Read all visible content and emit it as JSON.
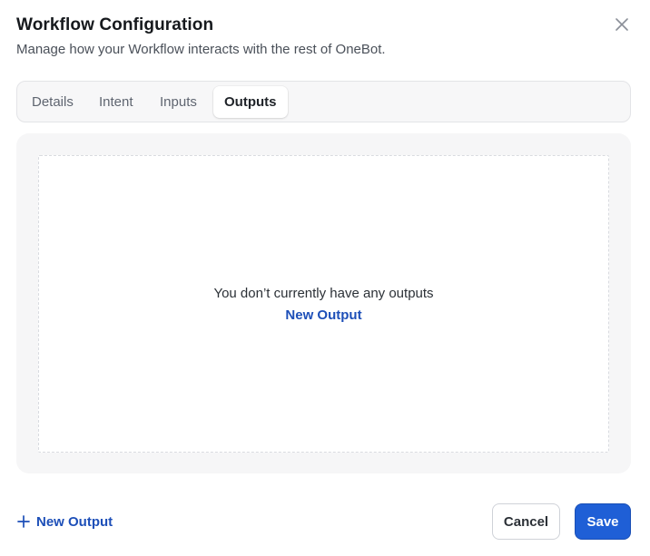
{
  "dialog": {
    "title": "Workflow Configuration",
    "subtitle": "Manage how your Workflow interacts with the rest of OneBot.",
    "close_icon": "close-icon"
  },
  "tabs": [
    {
      "label": "Details",
      "active": false
    },
    {
      "label": "Intent",
      "active": false
    },
    {
      "label": "Inputs",
      "active": false
    },
    {
      "label": "Outputs",
      "active": true
    }
  ],
  "empty_state": {
    "message": "You don’t currently have any outputs",
    "link_label": "New Output"
  },
  "footer": {
    "add_label": "New Output",
    "add_icon": "plus-icon",
    "cancel_label": "Cancel",
    "save_label": "Save"
  },
  "colors": {
    "accent": "#1f5fd6",
    "link": "#1d4fb8"
  }
}
